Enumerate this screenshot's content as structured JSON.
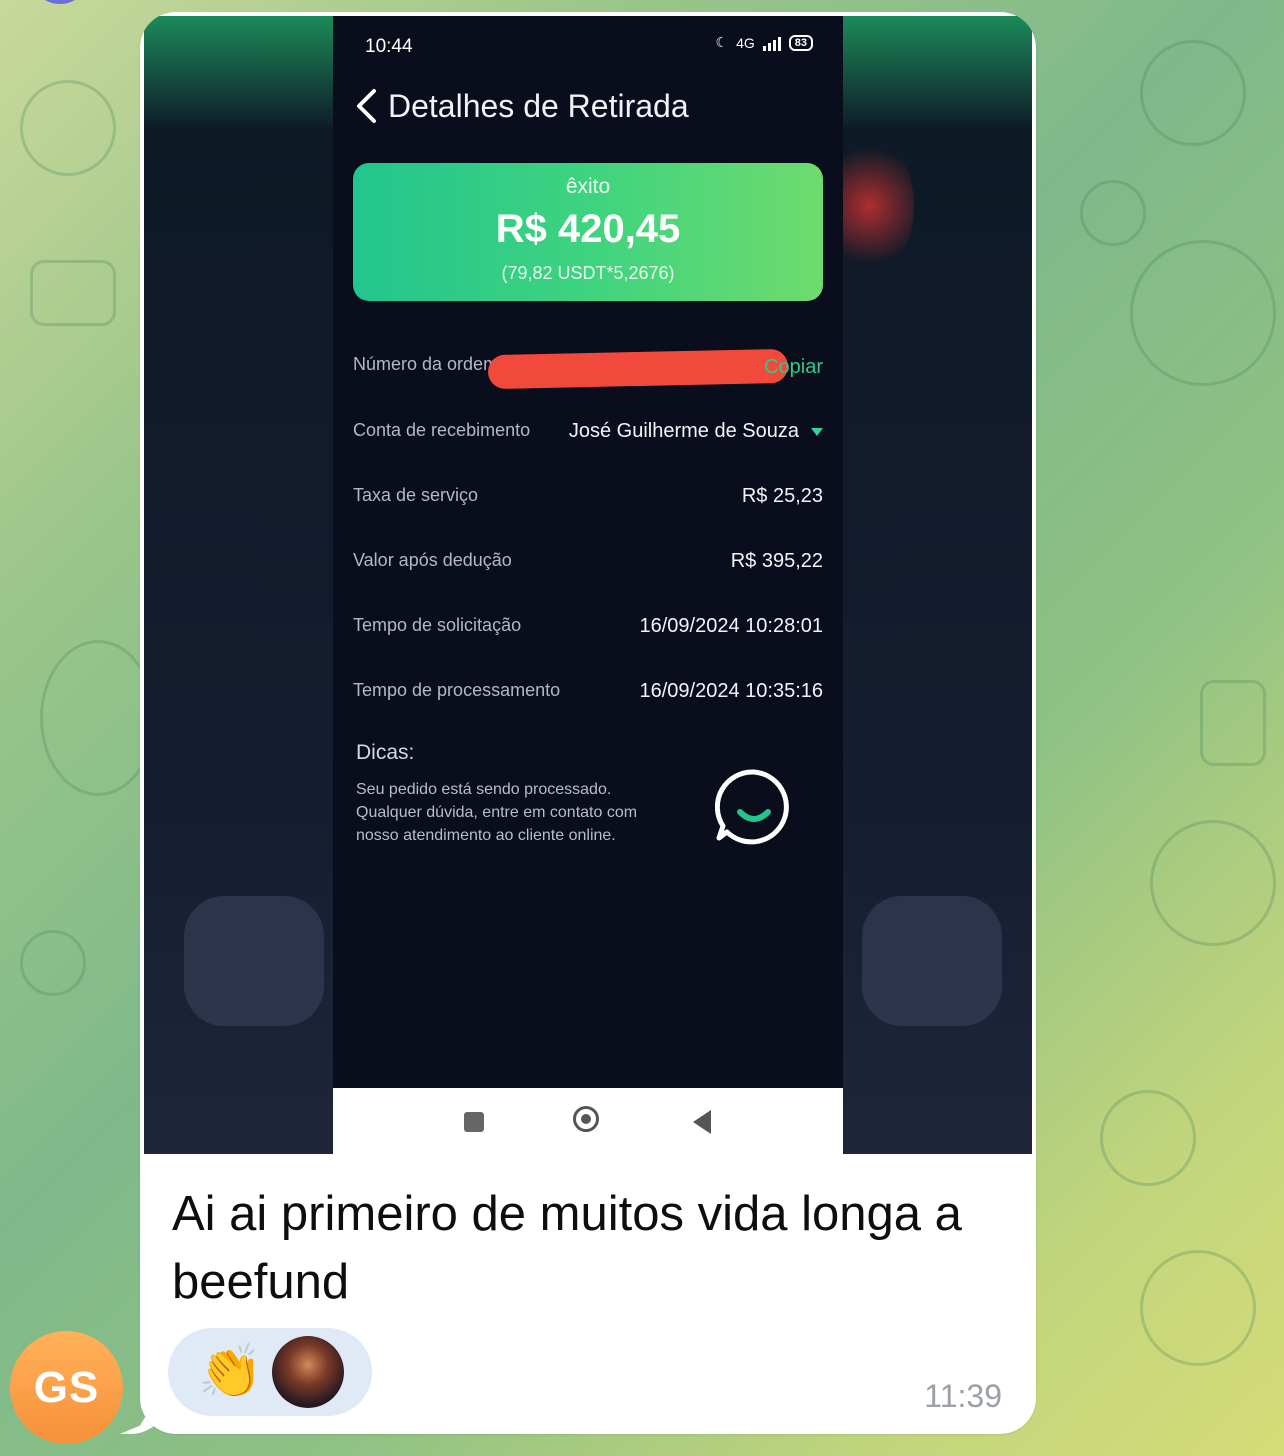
{
  "sender": {
    "initials": "GS",
    "color": "#f7913a"
  },
  "message": {
    "caption": "Ai ai primeiro de muitos vida longa a beefund",
    "time": "11:39",
    "reactions": [
      {
        "type": "emoji",
        "value": "👏"
      },
      {
        "type": "user-avatar",
        "icon": "user-avatar-icon"
      }
    ]
  },
  "screenshot": {
    "status_bar": {
      "time": "10:44",
      "battery": "83",
      "network": "4G"
    },
    "title": "Detalhes de Retirada",
    "card": {
      "status": "êxito",
      "amount": "R$ 420,45",
      "conversion": "(79,82 USDT*5,2676)"
    },
    "rows": {
      "order_number": {
        "label": "Número da ordem",
        "action": "Copiar"
      },
      "account": {
        "label": "Conta de recebimento",
        "value": "José Guilherme de Souza"
      },
      "fee": {
        "label": "Taxa de serviço",
        "value": "R$ 25,23"
      },
      "net": {
        "label": "Valor após dedução",
        "value": "R$ 395,22"
      },
      "request_time": {
        "label": "Tempo de solicitação",
        "value": "16/09/2024 10:28:01"
      },
      "processing_time": {
        "label": "Tempo de processamento",
        "value": "16/09/2024 10:35:16"
      }
    },
    "tips": {
      "title": "Dicas:",
      "body": "Seu pedido está sendo processado.\nQualquer dúvida, entre em contato com\nnosso atendimento ao cliente online."
    }
  },
  "colors": {
    "accent": "#2fc98a",
    "card_start": "#22c58e",
    "card_end": "#6fdb6e",
    "redaction": "#f14a3c"
  }
}
